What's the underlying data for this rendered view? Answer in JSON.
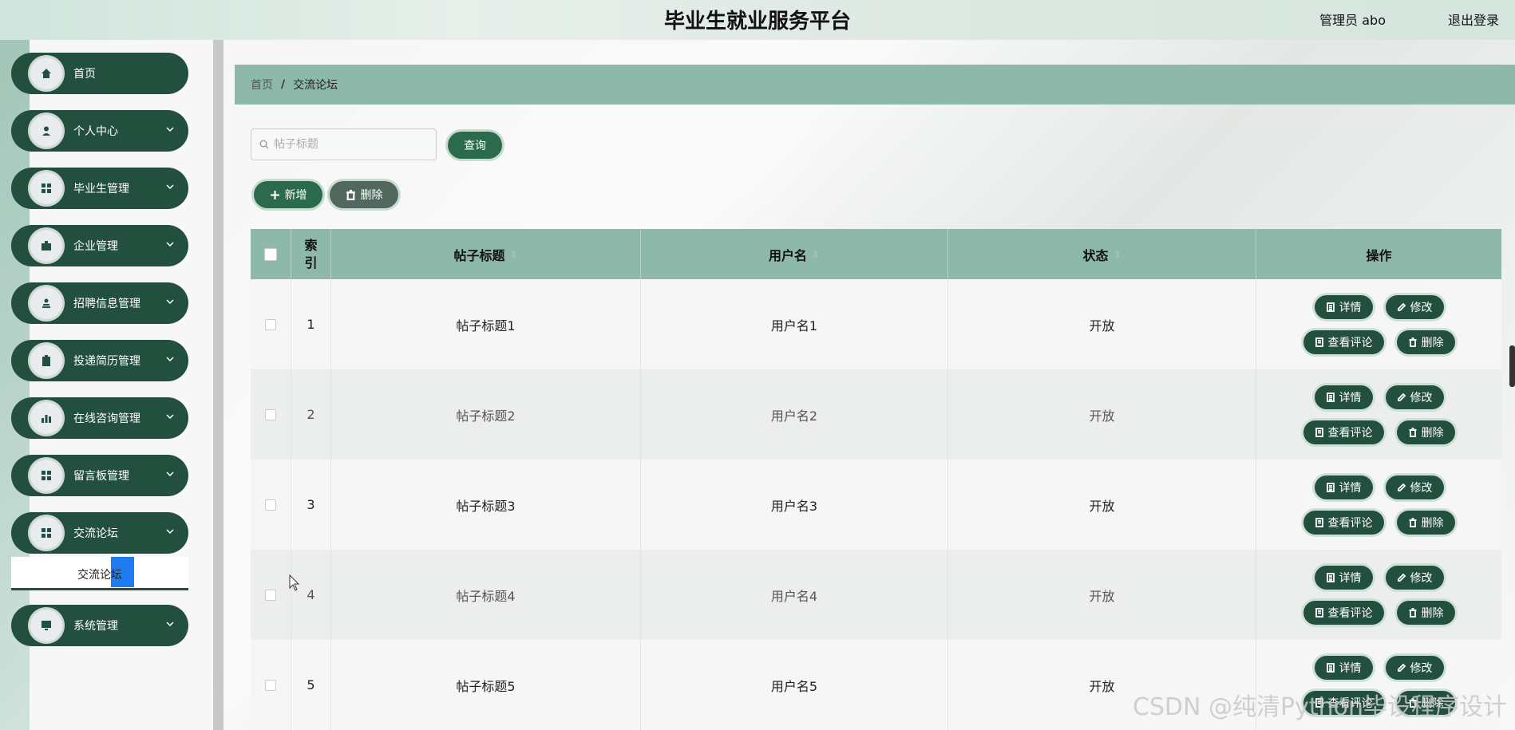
{
  "header": {
    "title": "毕业生就业服务平台",
    "admin": "管理员 abo",
    "logout": "退出登录"
  },
  "sidebar": {
    "items": [
      {
        "label": "首页",
        "icon": "home-icon"
      },
      {
        "label": "个人中心",
        "icon": "user-icon"
      },
      {
        "label": "毕业生管理",
        "icon": "grid-icon"
      },
      {
        "label": "企业管理",
        "icon": "briefcase-icon"
      },
      {
        "label": "招聘信息管理",
        "icon": "person-stamp-icon"
      },
      {
        "label": "投递简历管理",
        "icon": "clipboard-icon"
      },
      {
        "label": "在线咨询管理",
        "icon": "bar-chart-icon"
      },
      {
        "label": "留言板管理",
        "icon": "grid-icon"
      },
      {
        "label": "交流论坛",
        "icon": "grid-icon"
      },
      {
        "label": "系统管理",
        "icon": "monitor-icon"
      }
    ],
    "submenu_label": "交流论坛"
  },
  "breadcrumb": {
    "home": "首页",
    "separator": "/",
    "current": "交流论坛"
  },
  "search": {
    "placeholder": "帖子标题",
    "query_label": "查询"
  },
  "toolbar": {
    "add_label": "新增",
    "delete_label": "删除"
  },
  "table": {
    "headers": {
      "index": "索引",
      "title": "帖子标题",
      "user": "用户名",
      "status": "状态",
      "ops": "操作"
    },
    "rows": [
      {
        "index": "1",
        "title": "帖子标题1",
        "user": "用户名1",
        "status": "开放"
      },
      {
        "index": "2",
        "title": "帖子标题2",
        "user": "用户名2",
        "status": "开放"
      },
      {
        "index": "3",
        "title": "帖子标题3",
        "user": "用户名3",
        "status": "开放"
      },
      {
        "index": "4",
        "title": "帖子标题4",
        "user": "用户名4",
        "status": "开放"
      },
      {
        "index": "5",
        "title": "帖子标题5",
        "user": "用户名5",
        "status": "开放"
      }
    ],
    "row_actions": {
      "detail": "详情",
      "edit": "修改",
      "comments": "查看评论",
      "delete": "删除"
    }
  },
  "watermark": "CSDN @纯清Python毕设程序设计",
  "colors": {
    "primary": "#234f3f",
    "header_bar": "#8db8aa"
  }
}
